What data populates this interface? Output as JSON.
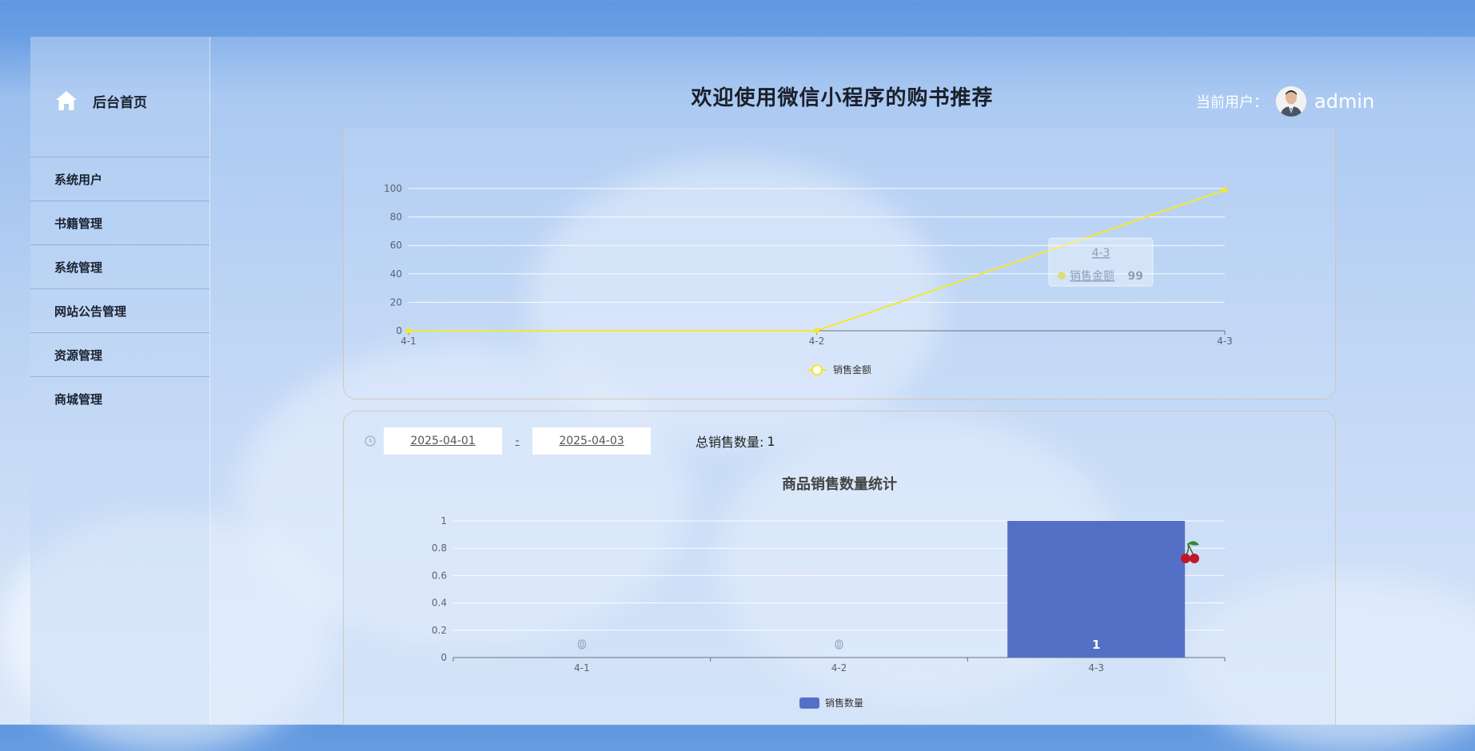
{
  "app": {
    "home_label": "后台首页",
    "title": "欢迎使用微信小程序的购书推荐",
    "user_label": "当前用户：",
    "user_name": "admin"
  },
  "sidebar": {
    "items": [
      {
        "label": "系统用户"
      },
      {
        "label": "书籍管理"
      },
      {
        "label": "系统管理"
      },
      {
        "label": "网站公告管理"
      },
      {
        "label": "资源管理"
      },
      {
        "label": "商城管理"
      }
    ]
  },
  "filters": {
    "start_date": "2025-04-01",
    "separator": "-",
    "end_date": "2025-04-03",
    "total_label": "总销售数量:",
    "total_value": "1"
  },
  "colors": {
    "line": "#f2e92c",
    "bar": "#5470c6"
  },
  "chart_data": [
    {
      "type": "line",
      "title": "",
      "categories": [
        "4-1",
        "4-2",
        "4-3"
      ],
      "series": [
        {
          "name": "销售金额",
          "values": [
            0,
            0,
            99
          ]
        }
      ],
      "ylim": [
        0,
        100
      ],
      "yticks": [
        "0",
        "20",
        "40",
        "60",
        "80",
        "100"
      ],
      "grid": true,
      "legend": "bottom-center",
      "tooltip": {
        "category": "4-3",
        "series": "销售金额",
        "value": "99"
      }
    },
    {
      "type": "bar",
      "title": "商品销售数量统计",
      "categories": [
        "4-1",
        "4-2",
        "4-3"
      ],
      "series": [
        {
          "name": "销售数量",
          "values": [
            0,
            0,
            1
          ]
        }
      ],
      "ylim": [
        0,
        1
      ],
      "yticks": [
        "0",
        "0.2",
        "0.4",
        "0.6",
        "0.8",
        "1"
      ],
      "grid": true,
      "legend": "bottom-center",
      "data_labels": [
        "0",
        "0",
        "1"
      ]
    }
  ]
}
